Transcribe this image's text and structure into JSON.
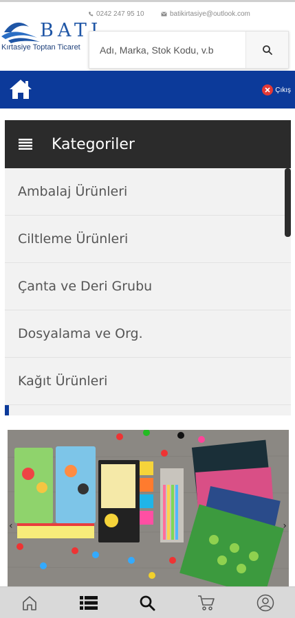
{
  "brand": {
    "name": "BATI",
    "tagline": "Kırtasiye Toptan Ticaret"
  },
  "contact": {
    "phone": "0242 247 95 10",
    "email": "batikirtasiye@outlook.com"
  },
  "search": {
    "placeholder": "Adı, Marka, Stok Kodu, v.b"
  },
  "nav": {
    "logout_label": "Çıkış"
  },
  "categories": {
    "title": "Kategoriler",
    "items": [
      "Ambalaj Ürünleri",
      "Ciltleme Ürünleri",
      "Çanta ve Deri Grubu",
      "Dosyalama ve Org.",
      "Kağıt Ürünleri"
    ]
  },
  "colors": {
    "primary": "#0c3a9a",
    "header_dark": "#2b2b2b",
    "logout_red": "#e53935",
    "list_bg": "#f2f2f2"
  },
  "bottom_nav": [
    "home-icon",
    "list-icon",
    "search-icon",
    "cart-icon",
    "user-icon"
  ]
}
